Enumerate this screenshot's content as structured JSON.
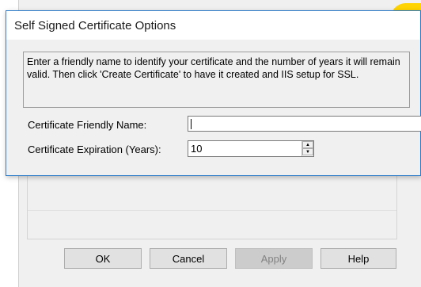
{
  "dialog": {
    "title": "Self Signed Certificate Options",
    "info_text": "Enter a friendly name to identify your certificate and the number of years it will remain valid.  Then click 'Create Certificate' to have it created and IIS setup for SSL.",
    "fields": {
      "friendly_name_label": "Certificate Friendly Name:",
      "friendly_name_value": "",
      "expiration_label": "Certificate Expiration (Years):",
      "expiration_value": "10"
    }
  },
  "parent_dialog": {
    "buttons": {
      "ok": "OK",
      "cancel": "Cancel",
      "apply": "Apply",
      "help": "Help"
    }
  },
  "colors": {
    "accent_border": "#2b7bc9",
    "highlight_yellow": "#ffd400"
  }
}
